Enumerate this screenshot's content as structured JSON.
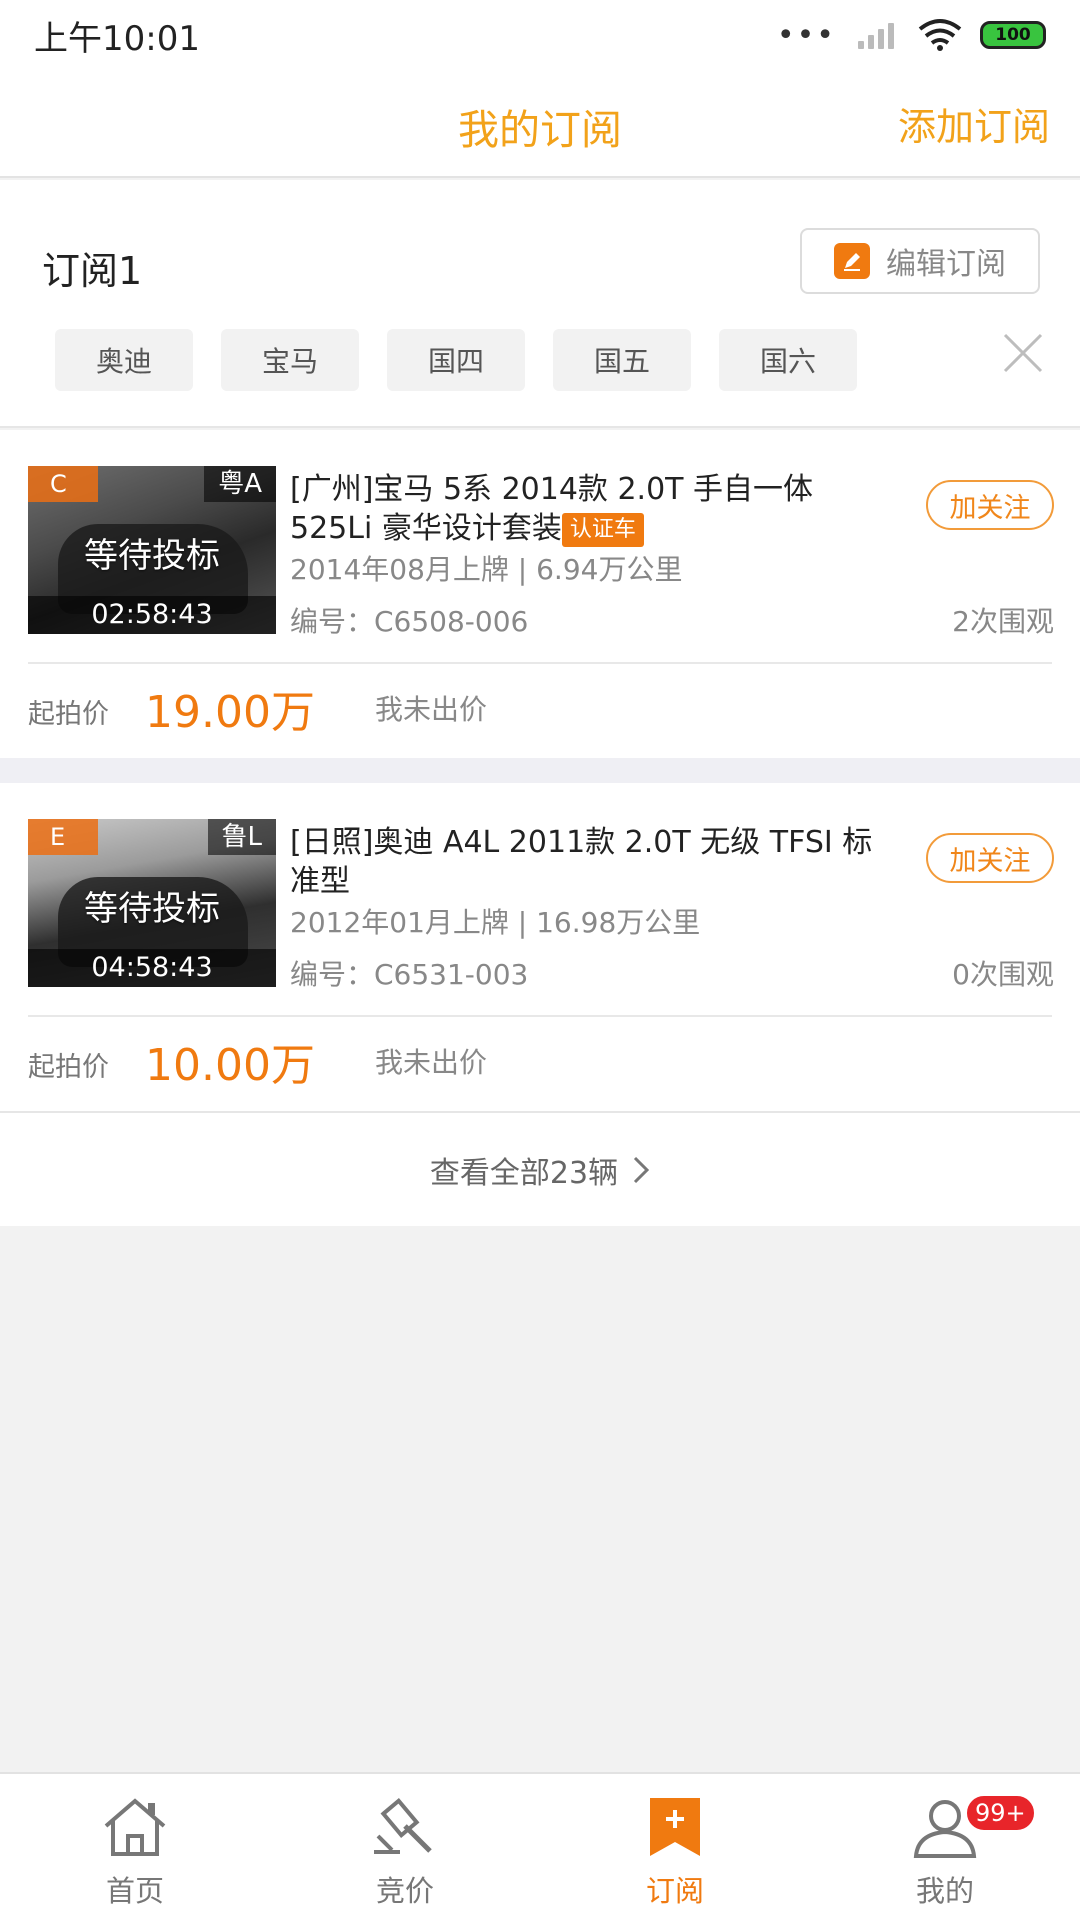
{
  "status_bar": {
    "time": "上午10:01",
    "dots": "•••",
    "battery": "100"
  },
  "header": {
    "title": "我的订阅",
    "add_label": "添加订阅"
  },
  "subscription": {
    "name": "订阅1",
    "edit_label": "编辑订阅",
    "tags": [
      "奥迪",
      "宝马",
      "国四",
      "国五",
      "国六"
    ]
  },
  "cars": [
    {
      "grade": "C",
      "plate": "粤A",
      "status": "等待投标",
      "countdown": "02:58:43",
      "title": "[广州]宝马 5系 2014款 2.0T 手自一体 525Li 豪华设计套装",
      "badge": "认证车",
      "registration": "2014年08月上牌 | 6.94万公里",
      "code": "编号：C6508-006",
      "views": "2次围观",
      "follow_label": "加关注",
      "price_label": "起拍价",
      "price": "19.00万",
      "bid_status": "我未出价"
    },
    {
      "grade": "E",
      "plate": "鲁L",
      "status": "等待投标",
      "countdown": "04:58:43",
      "title": "[日照]奥迪 A4L 2011款 2.0T 无级 TFSI 标准型",
      "badge": "",
      "registration": "2012年01月上牌 | 16.98万公里",
      "code": "编号：C6531-003",
      "views": "0次围观",
      "follow_label": "加关注",
      "price_label": "起拍价",
      "price": "10.00万",
      "bid_status": "我未出价"
    }
  ],
  "view_all_label": "查看全部23辆",
  "tabbar": {
    "items": [
      {
        "label": "首页",
        "icon": "home-icon"
      },
      {
        "label": "竞价",
        "icon": "gavel-icon"
      },
      {
        "label": "订阅",
        "icon": "subscribe-bookmark-icon"
      },
      {
        "label": "我的",
        "icon": "user-icon"
      }
    ],
    "active_index": 2,
    "profile_badge": "99+"
  },
  "colors": {
    "accent": "#f2a21a",
    "price": "#f07a10",
    "badge_red": "#e8252a"
  }
}
